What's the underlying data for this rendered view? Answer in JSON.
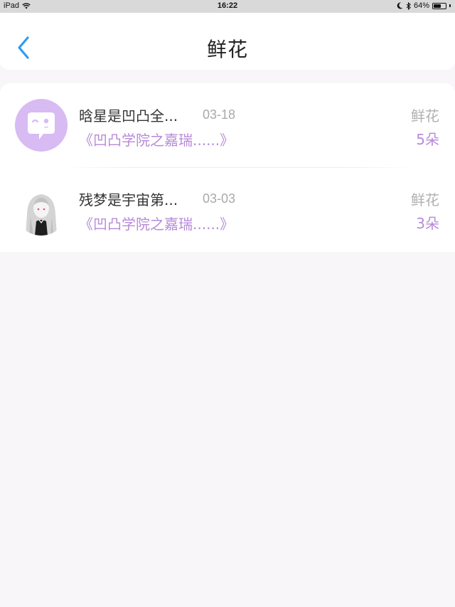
{
  "status_bar": {
    "device": "iPad",
    "time": "16:22",
    "battery": "64%",
    "battery_level": 0.64
  },
  "nav": {
    "title": "鲜花",
    "back_icon": "chevron-left-icon",
    "accent": "#2f9bf0"
  },
  "records": [
    {
      "name": "晗星是凹凸全...",
      "date": "03-18",
      "work": "《凹凸学院之嘉瑞......》",
      "gift": "鲜花",
      "count": "5朵",
      "avatar_icon": "chat-bubble-face-icon"
    },
    {
      "name": "残梦是宇宙第...",
      "date": "03-03",
      "work": "《凹凸学院之嘉瑞......》",
      "gift": "鲜花",
      "count": "3朵",
      "avatar_icon": "anime-girl-avatar"
    }
  ],
  "colors": {
    "accent_purple": "#b78ad9",
    "muted_gray": "#b0b0b0",
    "background": "#f8f6f8"
  }
}
